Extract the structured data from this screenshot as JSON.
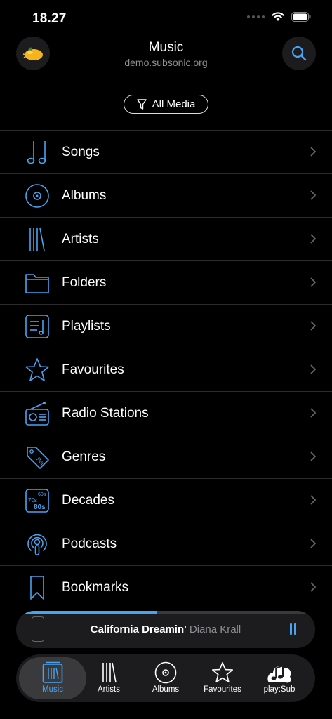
{
  "status_bar": {
    "time": "18.27"
  },
  "header": {
    "title": "Music",
    "subtitle": "demo.subsonic.org"
  },
  "filter": {
    "label": "All Media"
  },
  "menu": {
    "items": [
      {
        "label": "Songs",
        "icon": "music-notes-icon"
      },
      {
        "label": "Albums",
        "icon": "disc-icon"
      },
      {
        "label": "Artists",
        "icon": "artists-stack-icon"
      },
      {
        "label": "Folders",
        "icon": "folder-icon"
      },
      {
        "label": "Playlists",
        "icon": "playlist-icon"
      },
      {
        "label": "Favourites",
        "icon": "star-icon"
      },
      {
        "label": "Radio Stations",
        "icon": "radio-icon"
      },
      {
        "label": "Genres",
        "icon": "tag-icon"
      },
      {
        "label": "Decades",
        "icon": "decades-icon"
      },
      {
        "label": "Podcasts",
        "icon": "podcast-icon"
      },
      {
        "label": "Bookmarks",
        "icon": "bookmark-icon"
      }
    ]
  },
  "decades_icon_text": {
    "a": "60s",
    "b": "70s",
    "c": "80s"
  },
  "genre_icon_text": "Pop",
  "now_playing": {
    "title": "California Dreamin'",
    "artist": "Diana Krall",
    "progress": 0.47
  },
  "tab_bar": {
    "tabs": [
      {
        "label": "Music",
        "active": true
      },
      {
        "label": "Artists",
        "active": false
      },
      {
        "label": "Albums",
        "active": false
      },
      {
        "label": "Favourites",
        "active": false
      },
      {
        "label": "play:Sub",
        "active": false
      }
    ]
  },
  "colors": {
    "accent": "#4aa3f0",
    "background": "#000000",
    "separator": "#2c2c2e"
  }
}
